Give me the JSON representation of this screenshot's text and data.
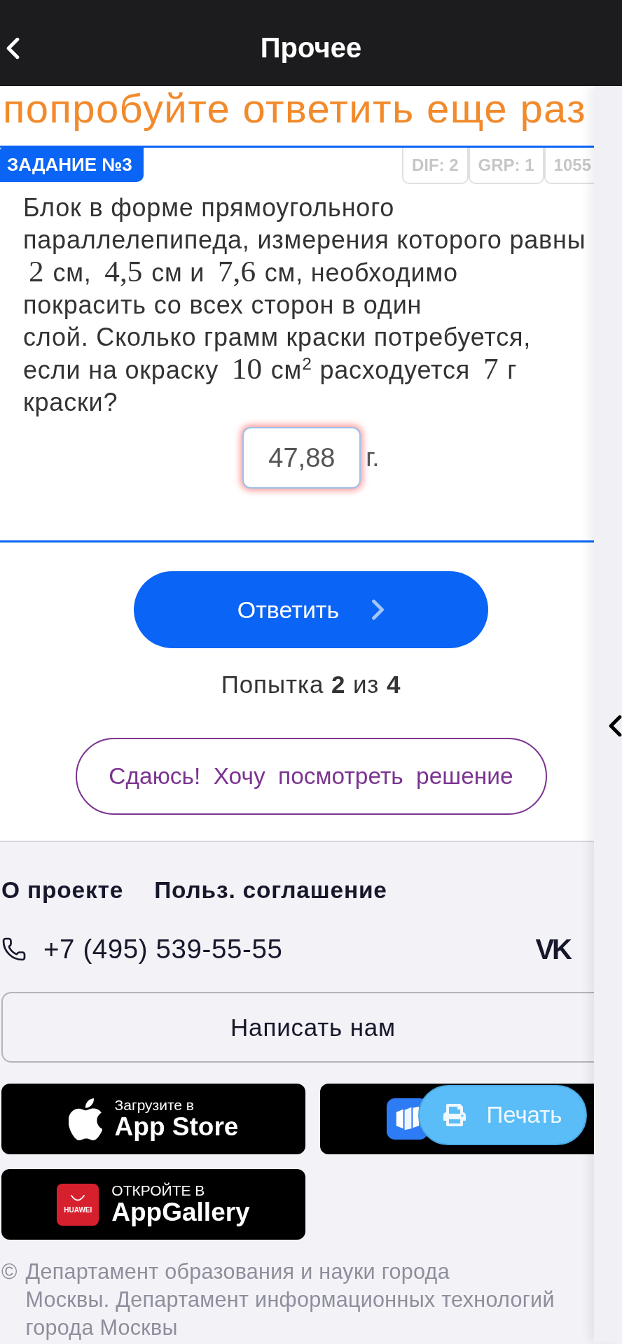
{
  "navigation": {
    "title": "Прочее"
  },
  "feedback": "попробуйте ответить еще раз",
  "task": {
    "badge": "ЗАДАНИЕ №3",
    "tags": [
      "DIF: 2",
      "GRP: 1",
      "1055"
    ],
    "question_lines": [
      [
        {
          "kind": "text",
          "text": "Блок в форме прямоугольного"
        }
      ],
      [
        {
          "kind": "text",
          "text": "параллелепипеда, измерения которого равны"
        }
      ],
      [
        {
          "kind": "math",
          "text": "2"
        },
        {
          "kind": "text",
          "text": " см, "
        },
        {
          "kind": "math",
          "text": "4,5"
        },
        {
          "kind": "text",
          "text": " см и "
        },
        {
          "kind": "math",
          "text": "7,6"
        },
        {
          "kind": "text",
          "text": " см, необходимо"
        }
      ],
      [
        {
          "kind": "text",
          "text": "покрасить со всех сторон в один"
        }
      ],
      [
        {
          "kind": "text",
          "text": "слой. Сколько грамм краски потребуется,"
        }
      ],
      [
        {
          "kind": "text",
          "text": "если на окраску "
        },
        {
          "kind": "math",
          "text": "10"
        },
        {
          "kind": "text",
          "text": " см$^{2}$ расходуется "
        },
        {
          "kind": "math",
          "text": "7"
        },
        {
          "kind": "text",
          "text": " г"
        }
      ],
      [
        {
          "kind": "text",
          "text": "краски?"
        }
      ]
    ],
    "answer": {
      "value": "47,88",
      "unit": "г.",
      "error": true
    }
  },
  "submit_button": "Ответить",
  "attempts": "Попытка **2** из **4**",
  "give_up_button": "Сдаюсь! Хочу посмотреть решение",
  "footer": {
    "links": [
      "О проекте",
      "Польз. соглашение"
    ],
    "phone": "+7 (495) 539-55-55",
    "social_link": "VK",
    "contact_button": "Написать нам",
    "stores": [
      {
        "kind": "apple",
        "caption": "Загрузите в",
        "name": "App Store"
      },
      {
        "kind": "rustore"
      },
      {
        "kind": "huawei",
        "logo_text": "HUAWEI",
        "caption": "ОТКРОЙТЕ В",
        "name": "AppGallery"
      }
    ],
    "copyright_sign": "©",
    "copyright_lines": [
      "Департамент образования и науки города",
      "Москвы. Департамент информационных технологий",
      "города Москвы"
    ]
  },
  "print_button": "Печать"
}
